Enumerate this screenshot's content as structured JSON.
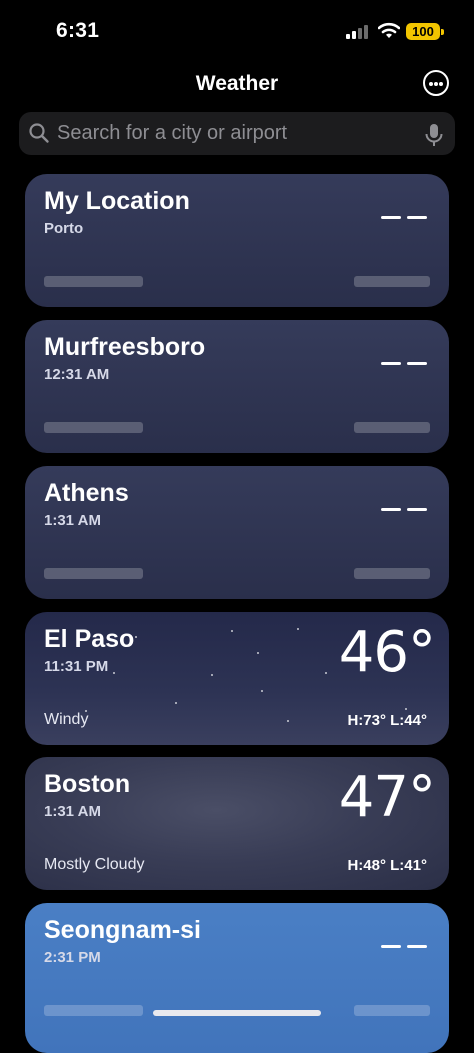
{
  "status": {
    "time": "6:31",
    "battery": "100"
  },
  "header": {
    "title": "Weather"
  },
  "search": {
    "placeholder": "Search for a city or airport"
  },
  "locations": [
    {
      "city": "My Location",
      "sub": "Porto",
      "temp": "– –",
      "loading": true
    },
    {
      "city": "Murfreesboro",
      "sub": "12:31 AM",
      "temp": "– –",
      "loading": true
    },
    {
      "city": "Athens",
      "sub": "1:31 AM",
      "temp": "– –",
      "loading": true
    },
    {
      "city": "El Paso",
      "sub": "11:31 PM",
      "temp": "46°",
      "condition": "Windy",
      "hilo": "H:73°  L:44°"
    },
    {
      "city": "Boston",
      "sub": "1:31 AM",
      "temp": "47°",
      "condition": "Mostly Cloudy",
      "hilo": "H:48°  L:41°"
    },
    {
      "city": "Seongnam-si",
      "sub": "2:31 PM",
      "temp": "– –",
      "loading": true
    }
  ],
  "colors": {
    "battery": "#f2c500",
    "day_card": "#4174bb",
    "night_card": "#2d3354"
  }
}
